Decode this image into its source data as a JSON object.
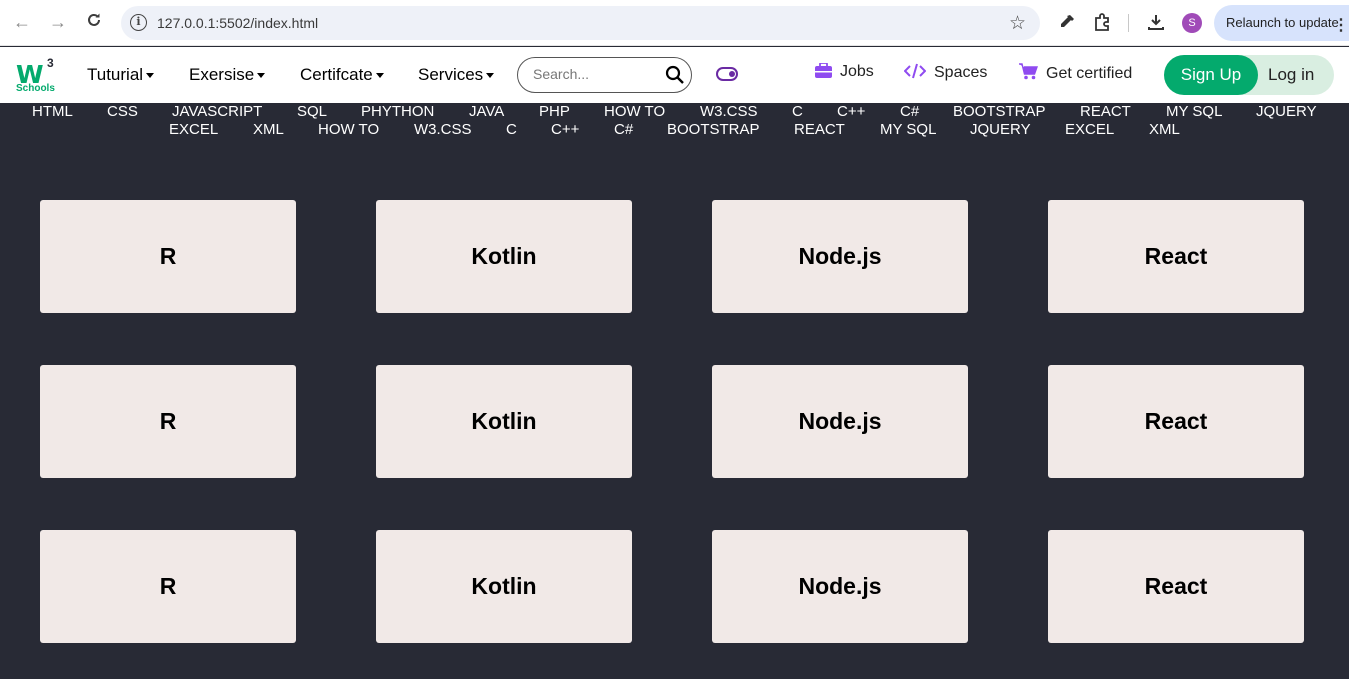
{
  "browser": {
    "url": "127.0.0.1:5502/index.html",
    "profile_initial": "S",
    "relaunch_label": "Relaunch to update",
    "icons": [
      "back-icon",
      "forward-icon",
      "reload-icon",
      "info-icon",
      "star-icon",
      "eyedropper-icon",
      "extensions-icon",
      "download-icon",
      "more-icon"
    ]
  },
  "header": {
    "logo": {
      "mark": "W",
      "superscript": "3",
      "caption": "Schools"
    },
    "menus": [
      "Tuturial",
      "Exersise",
      "Certifcate",
      "Services"
    ],
    "search_placeholder": "Search...",
    "links": {
      "jobs": "Jobs",
      "spaces": "Spaces",
      "certified": "Get certified"
    },
    "signup": "Sign Up",
    "login": "Log in",
    "colors": {
      "brand": "#04aa6d",
      "accent": "#8f4bf0",
      "dark": "#282a35"
    }
  },
  "topics": {
    "row1": [
      "HTML",
      "CSS",
      "JAVASCRIPT",
      "SQL",
      "PHYTHON",
      "JAVA",
      "PHP",
      "HOW TO",
      "W3.CSS",
      "C",
      "C++",
      "C#",
      "BOOTSTRAP",
      "REACT",
      "MY SQL",
      "JQUERY"
    ],
    "row2": [
      "EXCEL",
      "XML",
      "HOW TO",
      "W3.CSS",
      "C",
      "C++",
      "C#",
      "BOOTSTRAP",
      "REACT",
      "MY SQL",
      "JQUERY",
      "EXCEL",
      "XML"
    ]
  },
  "cards": {
    "row1": [
      "R",
      "Kotlin",
      "Node.js",
      "React"
    ],
    "row2": [
      "R",
      "Kotlin",
      "Node.js",
      "React"
    ],
    "row3": [
      "R",
      "Kotlin",
      "Node.js",
      "React"
    ]
  }
}
